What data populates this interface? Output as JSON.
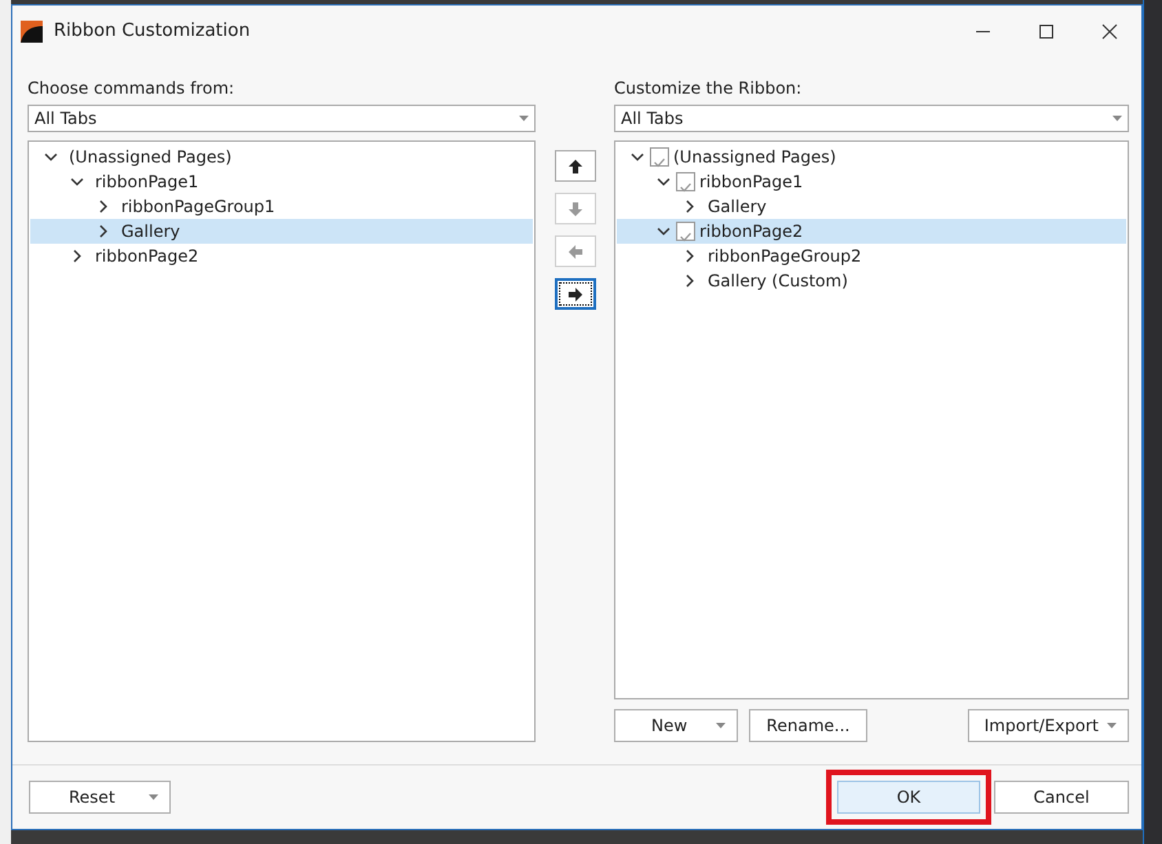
{
  "window": {
    "title": "Ribbon Customization"
  },
  "left_panel": {
    "label": "Choose commands from:",
    "combo": "All Tabs",
    "tree": [
      {
        "text": "(Unassigned Pages)",
        "expanded": true,
        "selected": false,
        "children": [
          {
            "text": "ribbonPage1",
            "expanded": true,
            "selected": false,
            "children": [
              {
                "text": "ribbonPageGroup1",
                "expanded": false,
                "selected": false
              },
              {
                "text": "Gallery",
                "expanded": false,
                "selected": true
              }
            ]
          },
          {
            "text": "ribbonPage2",
            "expanded": false,
            "selected": false
          }
        ]
      }
    ]
  },
  "move_buttons": [
    {
      "kind": "up",
      "disabled": false,
      "focused": false
    },
    {
      "kind": "down",
      "disabled": true,
      "focused": false
    },
    {
      "kind": "left",
      "disabled": true,
      "focused": false
    },
    {
      "kind": "right",
      "disabled": false,
      "focused": true
    }
  ],
  "right_panel": {
    "label": "Customize the Ribbon:",
    "combo": "All Tabs",
    "tree": [
      {
        "text": "(Unassigned Pages)",
        "expanded": true,
        "selected": false,
        "checked": true,
        "children": [
          {
            "text": "ribbonPage1",
            "expanded": true,
            "selected": false,
            "checked": true,
            "children": [
              {
                "text": "Gallery",
                "expanded": false,
                "selected": false
              }
            ]
          },
          {
            "text": "ribbonPage2",
            "expanded": true,
            "selected": true,
            "checked": true,
            "children": [
              {
                "text": "ribbonPageGroup2",
                "expanded": false,
                "selected": false
              },
              {
                "text": "Gallery (Custom)",
                "expanded": false,
                "selected": false
              }
            ]
          }
        ]
      }
    ],
    "buttons": [
      {
        "label": "New",
        "dropdown": true
      },
      {
        "label": "Rename...",
        "dropdown": false
      },
      {
        "label": "Import/Export",
        "dropdown": true
      }
    ]
  },
  "footer": {
    "reset": {
      "label": "Reset",
      "dropdown": true
    },
    "ok": {
      "label": "OK",
      "highlighted": true
    },
    "cancel": {
      "label": "Cancel"
    }
  }
}
